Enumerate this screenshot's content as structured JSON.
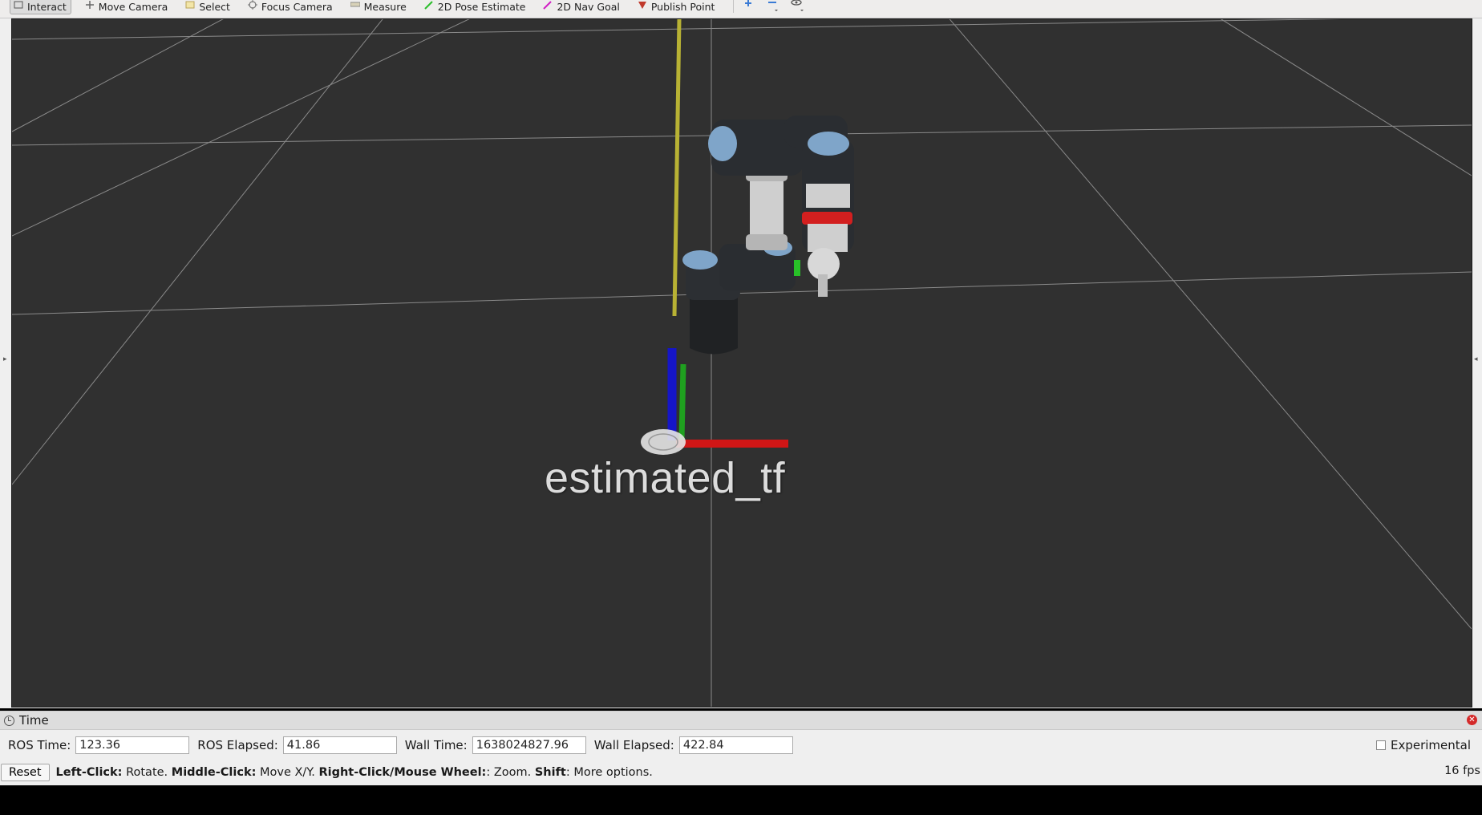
{
  "toolbar": {
    "tools": [
      {
        "label": "Interact",
        "icon": "interact-icon",
        "active": true
      },
      {
        "label": "Move Camera",
        "icon": "move-camera-icon"
      },
      {
        "label": "Select",
        "icon": "select-icon"
      },
      {
        "label": "Focus Camera",
        "icon": "focus-camera-icon"
      },
      {
        "label": "Measure",
        "icon": "measure-icon"
      },
      {
        "label": "2D Pose Estimate",
        "icon": "pose-estimate-icon",
        "color": "#2bbd2b"
      },
      {
        "label": "2D Nav Goal",
        "icon": "nav-goal-icon",
        "color": "#d11fc4"
      },
      {
        "label": "Publish Point",
        "icon": "publish-point-icon",
        "color": "#c0392b"
      }
    ],
    "extra_icons": [
      "add-tool-icon",
      "remove-tool-icon",
      "view-icon"
    ]
  },
  "viewport": {
    "background": "#303030",
    "frame_label": "estimated_tf"
  },
  "time_panel": {
    "title": "Time",
    "fields": [
      {
        "label": "ROS Time:",
        "value": "123.36"
      },
      {
        "label": "ROS Elapsed:",
        "value": "41.86"
      },
      {
        "label": "Wall Time:",
        "value": "1638024827.96"
      },
      {
        "label": "Wall Elapsed:",
        "value": "422.84"
      }
    ],
    "experimental_label": "Experimental",
    "experimental_checked": false
  },
  "status": {
    "reset_label": "Reset",
    "help_parts": [
      {
        "bold": "Left-Click:",
        "text": " Rotate. "
      },
      {
        "bold": "Middle-Click:",
        "text": " Move X/Y. "
      },
      {
        "bold": "Right-Click/Mouse Wheel:",
        "text": ": Zoom. "
      },
      {
        "bold": "Shift",
        "text": ": More options."
      }
    ],
    "fps": "16 fps"
  }
}
